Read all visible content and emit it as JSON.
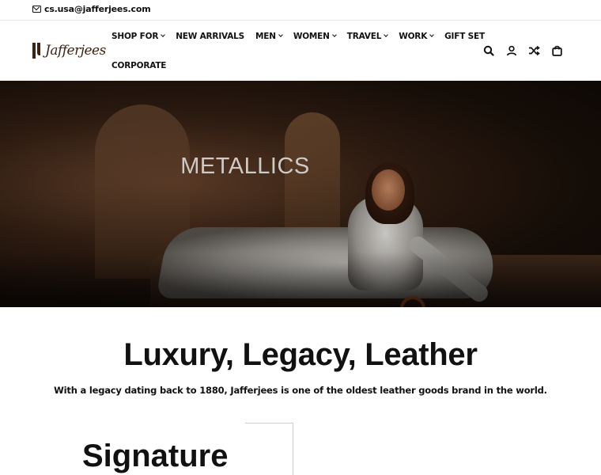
{
  "topbar": {
    "email": "cs.usa@jafferjees.com"
  },
  "logo": {
    "text": "Jafferjees"
  },
  "nav": {
    "items": [
      {
        "label": "SHOP FOR",
        "dropdown": true
      },
      {
        "label": "NEW ARRIVALS",
        "dropdown": false
      },
      {
        "label": "MEN",
        "dropdown": true
      },
      {
        "label": "WOMEN",
        "dropdown": true
      },
      {
        "label": "TRAVEL",
        "dropdown": true
      },
      {
        "label": "WORK",
        "dropdown": true
      },
      {
        "label": "GIFT SET",
        "dropdown": false
      },
      {
        "label": "CORPORATE",
        "dropdown": false
      }
    ]
  },
  "actions": {
    "icons": [
      "search-icon",
      "account-icon",
      "shuffle-icon",
      "bag-icon"
    ]
  },
  "hero": {
    "title": "METALLICS"
  },
  "intro": {
    "heading": "Luxury, Legacy, Leather",
    "text": "With a legacy dating back to 1880, Jafferjees is one of the oldest leather goods brand in the world."
  },
  "section": {
    "heading": "Signature"
  }
}
